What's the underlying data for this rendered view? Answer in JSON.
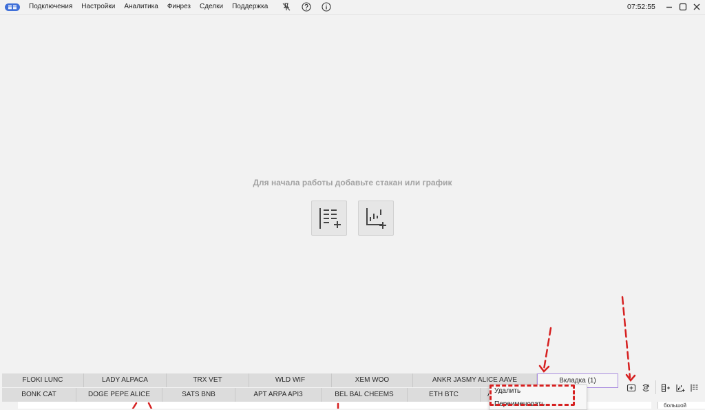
{
  "menu": {
    "items": [
      "Подключения",
      "Настройки",
      "Аналитика",
      "Финрез",
      "Сделки",
      "Поддержка"
    ],
    "icons": [
      "pin-off-icon",
      "help-icon",
      "info-icon"
    ]
  },
  "clock": "07:52:55",
  "center": {
    "hint": "Для начала работы добавьте стакан или график",
    "buttons": [
      "add-orderbook",
      "add-chart"
    ]
  },
  "tabs": {
    "row1": [
      "FLOKI LUNC",
      "LADY ALPACA",
      "TRX VET",
      "WLD WIF",
      "XEM WOO",
      "ANKR JASMY ALICE AAVE",
      "Вкладка (1)"
    ],
    "row2": [
      "BONK CAT",
      "DOGE PEPE ALICE",
      "SATS BNB",
      "APT ARPA API3",
      "BEL BAL CHEEMS",
      "ETH BTC",
      "AC"
    ],
    "active": "Вкладка (1)"
  },
  "context_menu": {
    "items": [
      "Удалить",
      "Переименовать"
    ]
  },
  "below_right_text": "большой",
  "colors": {
    "accent": "#a98ce0",
    "annotation": "#d62020",
    "logo": "#3f6fd8"
  }
}
